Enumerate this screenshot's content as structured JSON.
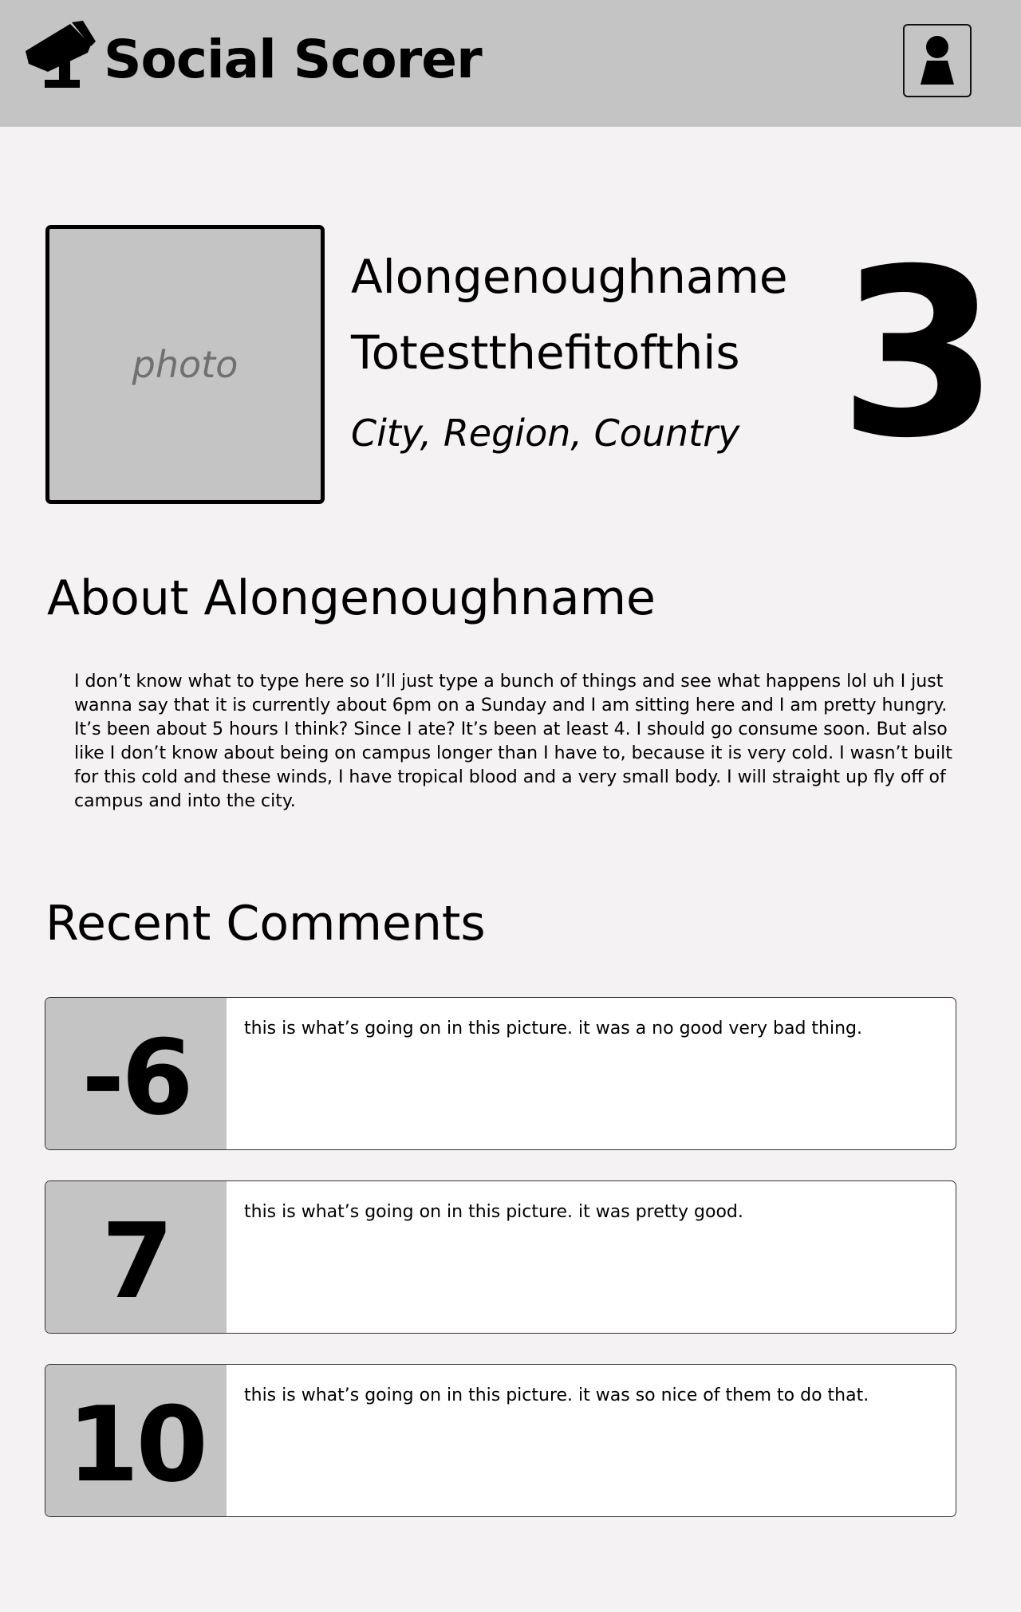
{
  "header": {
    "brand": "Social Scorer",
    "logo_icon": "security-camera-icon",
    "profile_icon": "user-icon"
  },
  "profile": {
    "photo_label": "photo",
    "first_name": "Alongenoughname",
    "last_name": "Totestthefitofthis",
    "location": "City, Region, Country",
    "score": "3"
  },
  "about": {
    "title": "About Alongenoughname",
    "text": "I don’t know what to type here so I’ll just type a bunch of things and see what happens lol uh I just wanna say that it is currently about 6pm on a Sunday and I am sitting here and I am pretty hungry. It’s been about 5 hours I think? Since I ate? It’s been at least 4. I should go consume soon. But also like I don’t know about being on campus longer than I have to, because it is very cold. I wasn’t built for this cold and these winds, I have tropical blood and a very small body. I will straight up fly off of campus and into the city."
  },
  "comments": {
    "title": "Recent Comments",
    "items": [
      {
        "score": "-6",
        "text": "this is what’s going on in this picture. it was a no good very bad thing."
      },
      {
        "score": "7",
        "text": "this is what’s going on in this picture. it was pretty good."
      },
      {
        "score": "10",
        "text": "this is what’s going on in this picture. it was so nice of them to do that."
      }
    ]
  },
  "colors": {
    "header_bg": "#c4c4c4",
    "page_bg": "#f4f2f3",
    "score_panel_bg": "#c4c4c4",
    "card_bg": "#ffffff"
  }
}
